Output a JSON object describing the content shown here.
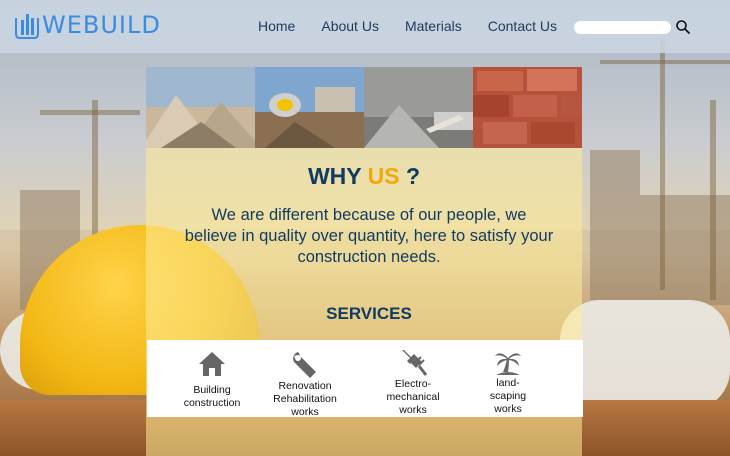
{
  "brand": {
    "name": "WEBUILD"
  },
  "nav": {
    "items": [
      {
        "label": "Home"
      },
      {
        "label": "About Us"
      },
      {
        "label": "Materials"
      },
      {
        "label": "Contact Us"
      }
    ]
  },
  "search": {
    "value": "",
    "icon": "search-icon"
  },
  "photos": [
    {
      "name": "gravel-pile-photo"
    },
    {
      "name": "cement-mixer-photo"
    },
    {
      "name": "cement-trowel-photo"
    },
    {
      "name": "bricks-photo"
    }
  ],
  "why": {
    "lead": "WHY",
    "accent": "US",
    "tail": "?",
    "accent_color": "#f2a80d"
  },
  "intro": "We are different because of our people, we believe in quality over quantity, here to satisfy your construction needs.",
  "services": {
    "title": "SERVICES",
    "items": [
      {
        "icon": "house-icon",
        "label": "Building\nconstruction"
      },
      {
        "icon": "wrench-icon",
        "label": "Renovation\nRehabilitation\nworks"
      },
      {
        "icon": "plug-icon",
        "label": "Electro-\nmechanical\nworks"
      },
      {
        "icon": "palm-tree-icon",
        "label": "land-\nscaping\nworks"
      }
    ]
  },
  "colors": {
    "brand": "#3c8be0",
    "text": "#123b63",
    "accent": "#f2a80d"
  }
}
